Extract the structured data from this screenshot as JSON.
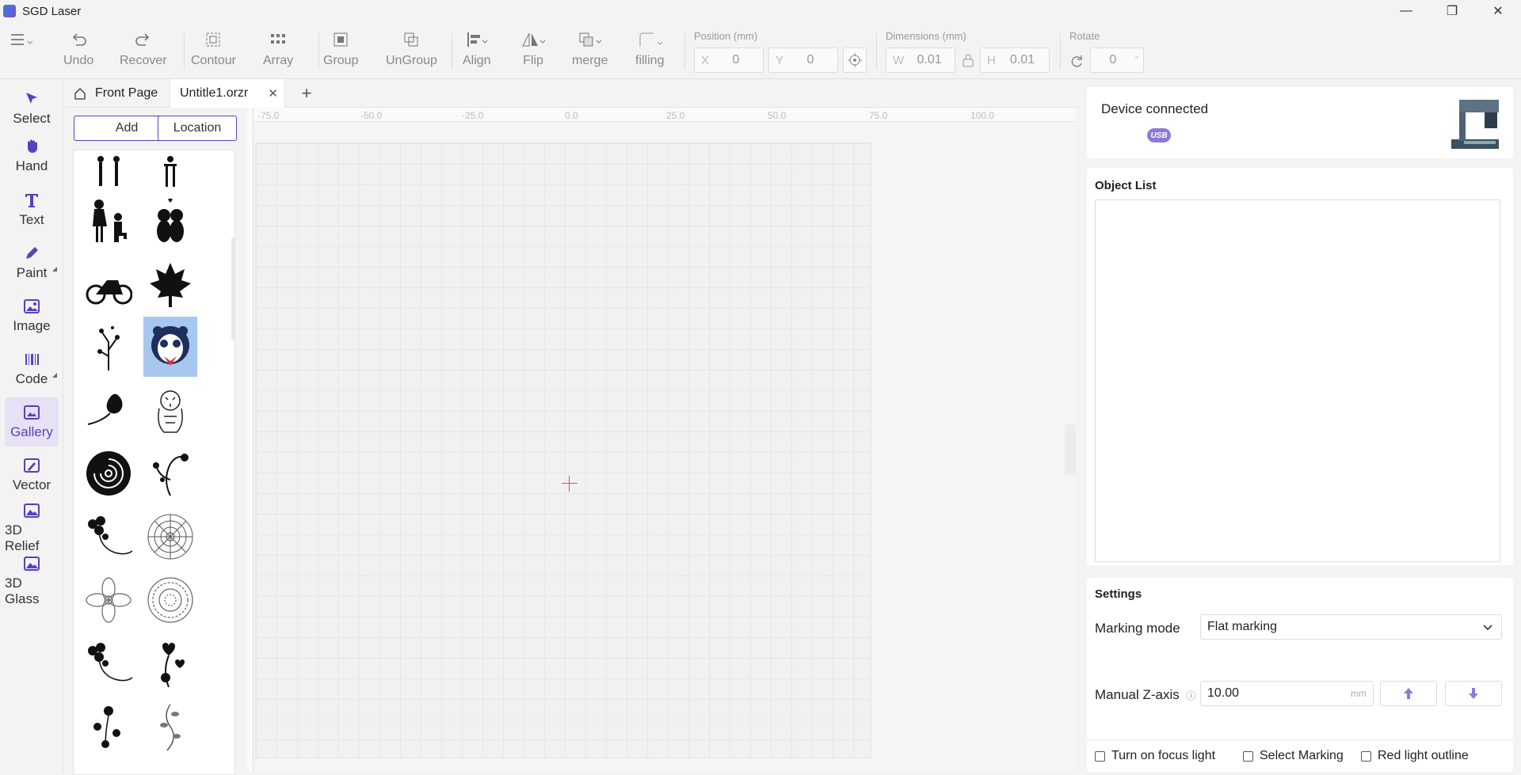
{
  "app": {
    "title": "SGD Laser"
  },
  "window": {
    "minimize": "—",
    "maximize": "❐",
    "close": "✕"
  },
  "toolbar": {
    "undo": "Undo",
    "recover": "Recover",
    "contour": "Contour",
    "array": "Array",
    "group": "Group",
    "ungroup": "UnGroup",
    "align": "Align",
    "flip": "Flip",
    "merge": "merge",
    "filling": "filling"
  },
  "position": {
    "label": "Position (mm)",
    "x_prefix": "X",
    "x": "0",
    "y_prefix": "Y",
    "y": "0"
  },
  "dimensions": {
    "label": "Dimensions (mm)",
    "w_prefix": "W",
    "w": "0.01",
    "h_prefix": "H",
    "h": "0.01"
  },
  "rotate": {
    "label": "Rotate",
    "value": "0",
    "unit": "°"
  },
  "sidebar": {
    "items": [
      {
        "label": "Select"
      },
      {
        "label": "Hand"
      },
      {
        "label": "Text"
      },
      {
        "label": "Paint"
      },
      {
        "label": "Image"
      },
      {
        "label": "Code"
      },
      {
        "label": "Gallery"
      },
      {
        "label": "Vector"
      },
      {
        "label": "3D Relief"
      },
      {
        "label": "3D Glass"
      }
    ]
  },
  "tabs": {
    "home": "Front Page",
    "file": "Untitle1.orzr",
    "close": "✕",
    "add": "+"
  },
  "gallery": {
    "add": "Add",
    "location": "Location"
  },
  "ruler": {
    "ticks": [
      "-75.0",
      "-50.0",
      "-25.0",
      "0.0",
      "25.0",
      "50.0",
      "75.0",
      "100.0"
    ]
  },
  "device": {
    "status": "Device connected",
    "conn": "USB"
  },
  "object_list": {
    "title": "Object List"
  },
  "settings": {
    "title": "Settings",
    "marking_mode_label": "Marking mode",
    "marking_mode_value": "Flat marking",
    "manual_z_label": "Manual Z-axis",
    "manual_z_value": "10.00",
    "manual_z_unit": "mm",
    "focus_light": "Turn on focus light",
    "select_marking": "Select Marking",
    "red_light": "Red light outline"
  },
  "colors": {
    "accent": "#5a3fbf",
    "selected_thumb": "#a7c7ee",
    "usb": "#8f79d6"
  }
}
